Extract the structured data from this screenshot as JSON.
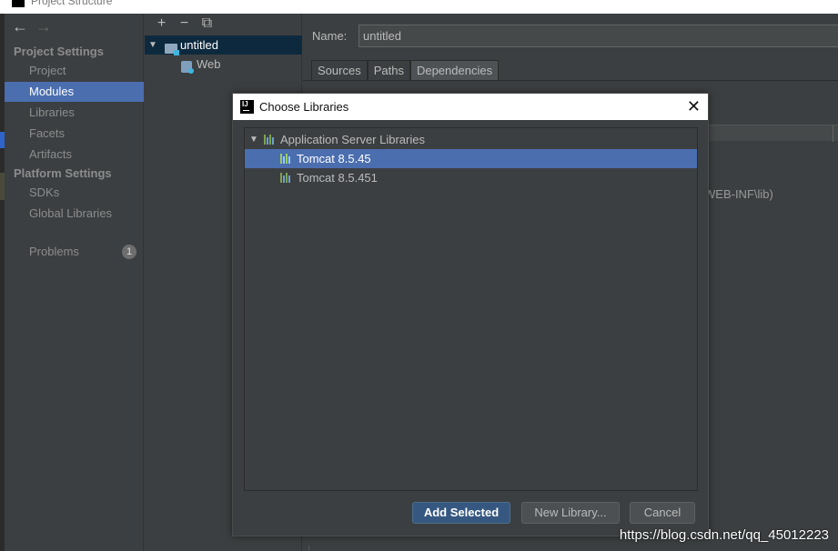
{
  "window": {
    "title": "Project Structure"
  },
  "nav": {
    "back_arrow": "←",
    "forward_arrow": "→"
  },
  "sidebar": {
    "project_settings_title": "Project Settings",
    "project_items": [
      {
        "label": "Project"
      },
      {
        "label": "Modules",
        "selected": true
      },
      {
        "label": "Libraries"
      },
      {
        "label": "Facets"
      },
      {
        "label": "Artifacts"
      }
    ],
    "platform_settings_title": "Platform Settings",
    "platform_items": [
      {
        "label": "SDKs"
      },
      {
        "label": "Global Libraries"
      }
    ],
    "problems": {
      "label": "Problems",
      "count": "1"
    }
  },
  "module_tree": {
    "toolbar": {
      "add": "+",
      "remove": "−",
      "copy": "⧉"
    },
    "items": [
      {
        "label": "untitled",
        "expanded": true,
        "selected": true
      },
      {
        "label": "Web"
      }
    ]
  },
  "module_panel": {
    "name_label": "Name:",
    "name_value": "untitled",
    "tabs": [
      {
        "label": "Sources"
      },
      {
        "label": "Paths"
      },
      {
        "label": "Dependencies",
        "active": true
      }
    ],
    "webinf_text": "WEB-INF\\lib)"
  },
  "dialog": {
    "title": "Choose Libraries",
    "close_label": "✕",
    "group": {
      "label": "Application Server Libraries",
      "expanded": true
    },
    "libraries": [
      {
        "label": "Tomcat 8.5.45",
        "selected": true
      },
      {
        "label": "Tomcat 8.5.451",
        "selected": false
      }
    ],
    "buttons": {
      "add_selected": "Add Selected",
      "new_library": "New Library...",
      "cancel": "Cancel"
    }
  },
  "watermark": "https://blog.csdn.net/qq_45012223",
  "colors": {
    "selection": "#4b6eaf",
    "primary_button": "#365880",
    "background": "#3c3f41"
  }
}
